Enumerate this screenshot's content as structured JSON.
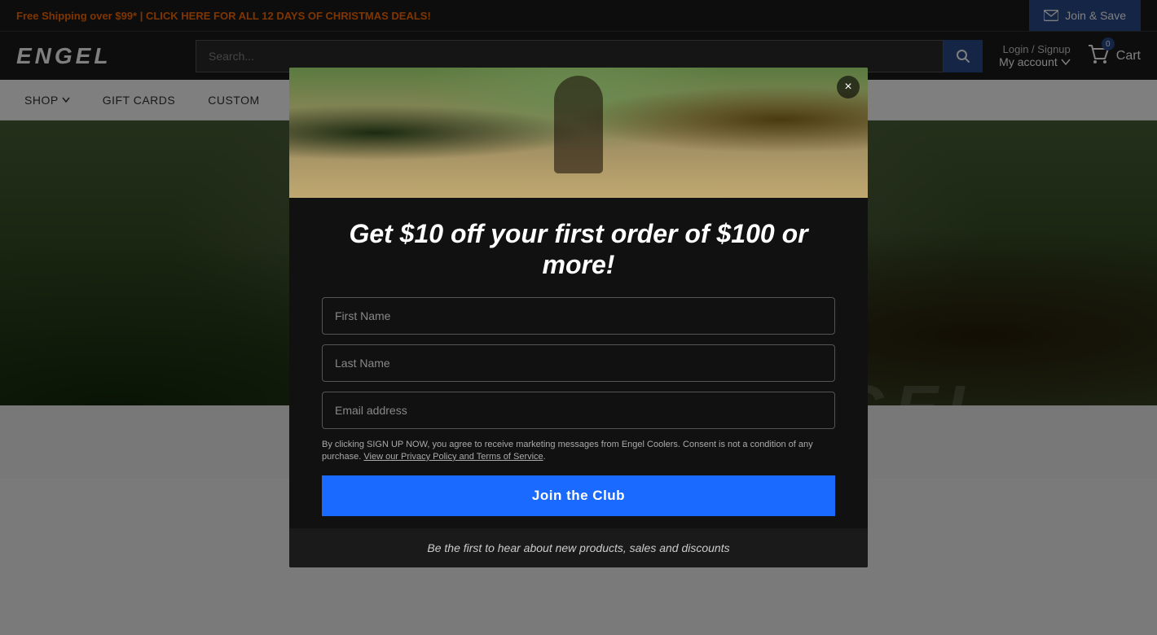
{
  "topBanner": {
    "text": "Free Shipping over $99* | CLICK HERE FOR ALL 12 DAYS OF CHRISTMAS DEALS!",
    "joinSaveLabel": "Join & Save"
  },
  "header": {
    "logoText": "ENGEL",
    "searchPlaceholder": "Search...",
    "loginLabel": "Login / Signup",
    "myAccountLabel": "My account",
    "cartCount": "0",
    "cartLabel": "Cart"
  },
  "nav": {
    "items": [
      {
        "label": "SHOP",
        "hasDropdown": true
      },
      {
        "label": "GIFT CARDS",
        "hasDropdown": false
      },
      {
        "label": "CUSTOM",
        "hasDropdown": false
      }
    ]
  },
  "modal": {
    "headline": "Get $10 off your first order of $100 or more!",
    "firstNamePlaceholder": "First Name",
    "lastNamePlaceholder": "Last Name",
    "emailPlaceholder": "Email address",
    "consentText": "By clicking SIGN UP NOW, you agree to receive marketing messages from Engel Coolers. Consent is not a condition of any purchase.",
    "privacyLinkText": "View our Privacy Policy and Terms of Service",
    "joinButtonLabel": "Join the Club",
    "footerText": "Be the first to hear about new products, sales and discounts",
    "closeLabel": "×"
  },
  "hero": {
    "watermark": "ENGEL"
  },
  "circles": [
    {
      "id": 1,
      "colorClass": "circle-1"
    },
    {
      "id": 2,
      "colorClass": "circle-2"
    },
    {
      "id": 3,
      "colorClass": "circle-3"
    },
    {
      "id": 4,
      "colorClass": "circle-4"
    },
    {
      "id": 5,
      "colorClass": "circle-5"
    },
    {
      "id": 6,
      "colorClass": "circle-6"
    }
  ]
}
